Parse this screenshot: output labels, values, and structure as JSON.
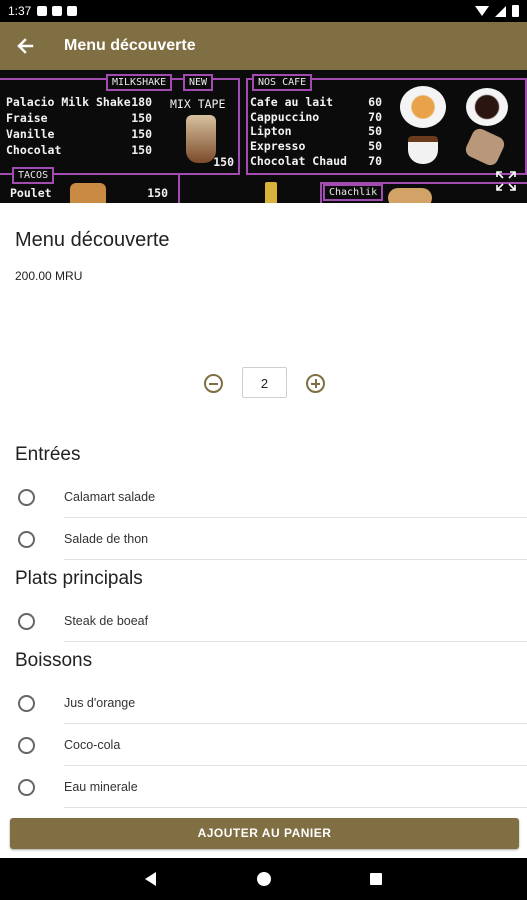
{
  "status_bar": {
    "time": "1:37"
  },
  "app_bar": {
    "title": "Menu découverte"
  },
  "hero": {
    "milkshake": {
      "tag": "MILKSHAKE",
      "items": [
        {
          "name": "Palacio Milk Shake",
          "price": "180"
        },
        {
          "name": "Fraise",
          "price": "150"
        },
        {
          "name": "Vanille",
          "price": "150"
        },
        {
          "name": "Chocolat",
          "price": "150"
        }
      ]
    },
    "new": {
      "tag": "NEW",
      "name": "MIX TAPE",
      "price": "150"
    },
    "cafe": {
      "tag": "NOS CAFE",
      "items": [
        {
          "name": "Cafe au lait",
          "price": "60"
        },
        {
          "name": "Cappuccino",
          "price": "70"
        },
        {
          "name": "Lipton",
          "price": "50"
        },
        {
          "name": "Expresso",
          "price": "50"
        },
        {
          "name": "Chocolat Chaud",
          "price": "70"
        }
      ]
    },
    "tacos": {
      "tag": "TACOS",
      "item": "Poulet",
      "price": "150"
    },
    "chachlik": {
      "tag": "Chachlik"
    }
  },
  "product": {
    "title": "Menu découverte",
    "price": "200.00 MRU"
  },
  "quantity": {
    "value": "2"
  },
  "sections": [
    {
      "title": "Entrées",
      "options": [
        "Calamart salade",
        "Salade de thon"
      ]
    },
    {
      "title": "Plats principals",
      "options": [
        "Steak de boeaf"
      ]
    },
    {
      "title": "Boissons",
      "options": [
        "Jus d'orange",
        "Coco-cola",
        "Eau minerale"
      ]
    }
  ],
  "add_button": {
    "label": "AJOUTER AU PANIER"
  },
  "colors": {
    "accent": "#816f44",
    "menu_border": "#a24bb0"
  },
  "icons": [
    "back-arrow-icon",
    "expand-icon",
    "minus-circle-icon",
    "plus-circle-icon",
    "radio-unchecked-icon"
  ]
}
